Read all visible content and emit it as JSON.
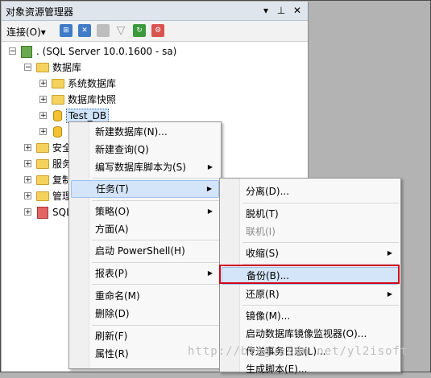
{
  "panel": {
    "title": "对象资源管理器",
    "pin_icon": "▾ ⊣",
    "close_glyph": "✕"
  },
  "toolbar": {
    "connect_label": "连接(O)▾"
  },
  "tree": {
    "server": ". (SQL Server 10.0.1600 - sa)",
    "databases": "数据库",
    "system_dbs": "系统数据库",
    "snapshots": "数据库快照",
    "selected_db": "Test_DB",
    "folder_security": "安全",
    "folder_server_objects": "服务",
    "folder_replication": "复制",
    "folder_management": "管理",
    "sql_agent": "SQL"
  },
  "context_menu": {
    "items": [
      {
        "label": "新建数据库(N)..."
      },
      {
        "label": "新建查询(Q)"
      },
      {
        "label": "编写数据库脚本为(S)"
      },
      {
        "label": "任务(T)"
      },
      {
        "label": "策略(O)"
      },
      {
        "label": "方面(A)"
      },
      {
        "label": "启动 PowerShell(H)"
      },
      {
        "label": "报表(P)"
      },
      {
        "label": "重命名(M)"
      },
      {
        "label": "删除(D)"
      },
      {
        "label": "刷新(F)"
      },
      {
        "label": "属性(R)"
      }
    ]
  },
  "tasks_submenu": {
    "items": [
      {
        "label": "分离(D)..."
      },
      {
        "label": "脱机(T)"
      },
      {
        "label": "联机(I)"
      },
      {
        "label": "收缩(S)"
      },
      {
        "label": "备份(B)..."
      },
      {
        "label": "还原(R)"
      },
      {
        "label": "镜像(M)..."
      },
      {
        "label": "启动数据库镜像监视器(O)..."
      },
      {
        "label": "传送事务日志(L)..."
      },
      {
        "label": "生成脚本(E)..."
      }
    ]
  },
  "watermark": "http://blog.csdn.net/yl2isoft",
  "colors": {
    "highlight": "#d4e5fa",
    "red_box": "#d0021b"
  }
}
